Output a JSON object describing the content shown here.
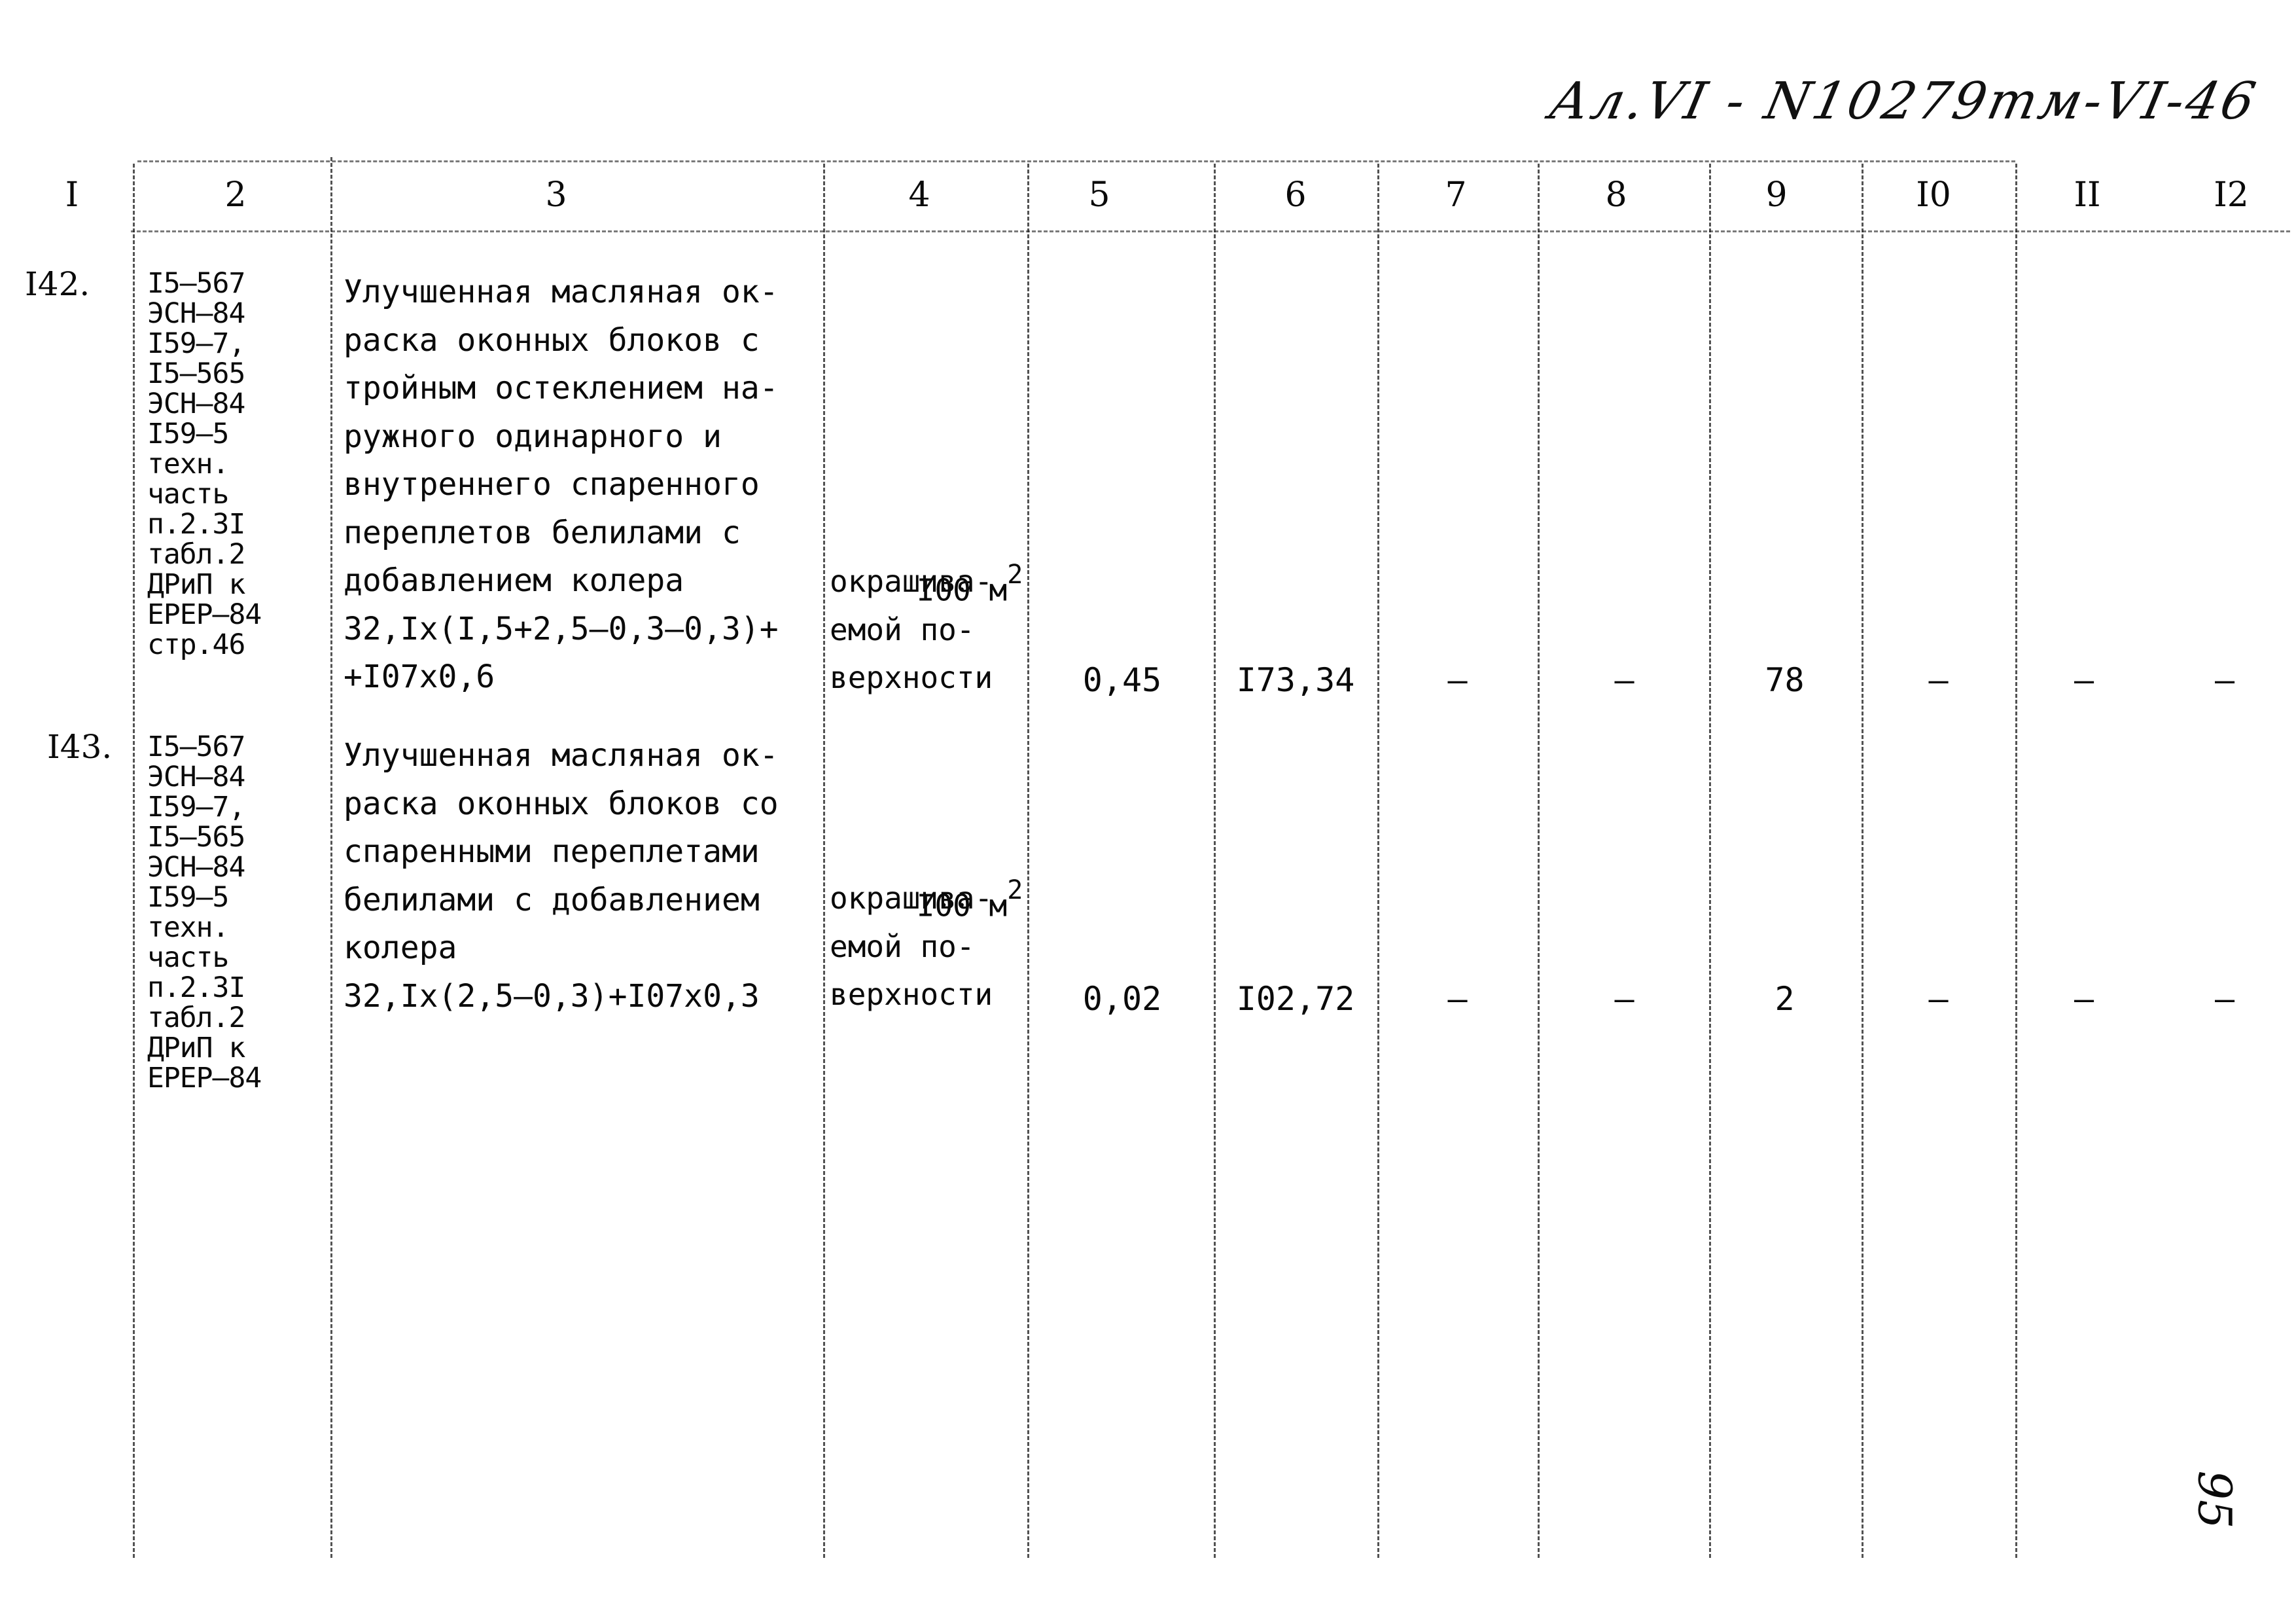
{
  "document": {
    "handwritten_code": "Ал.VI - N10279тм-VI-46",
    "page_number": "95"
  },
  "table": {
    "headers": [
      "I",
      "2",
      "3",
      "4",
      "5",
      "6",
      "7",
      "8",
      "9",
      "I0",
      "II",
      "I2"
    ],
    "rows": [
      {
        "num": "I42.",
        "refs": "I5–567\nЭСН–84\nI59–7,\nI5–565\nЭСН–84\nI59–5\nтехн.\nчасть\nп.2.3I\nтабл.2\nДРиП к\nЕРЕР–84\nстр.46",
        "description": "Улучшенная масляная ок-\nраска оконных блоков с\nтройным остеклением на-\nружного одинарного и\nвнутреннего спаренного\nпереплетов белилами с\nдобавлением колера\n32,Iх(I,5+2,5–0,3–0,3)+\n+I07х0,6",
        "unit_main": "I00 м",
        "unit_sup": "2",
        "unit_rest": "окрашива-\nемой по-\nверхности",
        "c5": "0,45",
        "c6": "I73,34",
        "c7": "–",
        "c8": "–",
        "c9": "78",
        "c10": "–",
        "c11": "–",
        "c12": "–"
      },
      {
        "num": "I43.",
        "refs": "I5–567\nЭСН–84\nI59–7,\nI5–565\nЭСН–84\nI59–5\nтехн.\nчасть\nп.2.3I\nтабл.2\nДРиП к\nЕРЕР–84",
        "description": "Улучшенная масляная ок-\nраска оконных блоков со\nспаренными переплетами\nбелилами с добавлением\nколера\n32,Iх(2,5–0,3)+I07х0,3",
        "unit_main": "I00 м",
        "unit_sup": "2",
        "unit_rest": "окрашива-\nемой по-\nверхности",
        "c5": "0,02",
        "c6": "I02,72",
        "c7": "–",
        "c8": "–",
        "c9": "2",
        "c10": "–",
        "c11": "–",
        "c12": "–"
      }
    ]
  }
}
